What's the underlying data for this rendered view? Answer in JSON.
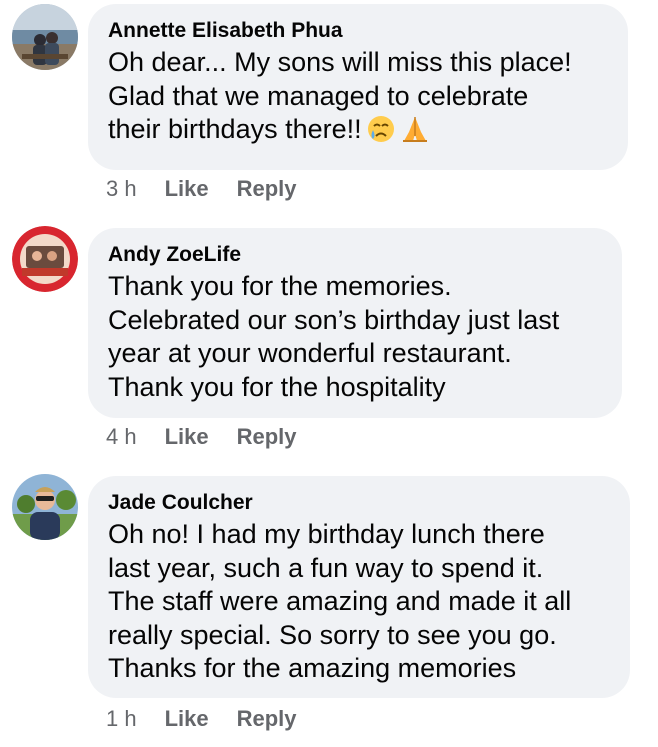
{
  "comments": [
    {
      "author": "Annette Elisabeth Phua",
      "lines": [
        "Oh dear... My sons will miss this place!",
        "Glad that we managed to celebrate",
        "their birthdays there!!"
      ],
      "emojis": [
        "crying-face",
        "folded-hands"
      ],
      "time": "3 h",
      "like": "Like",
      "reply": "Reply"
    },
    {
      "author": "Andy ZoeLife",
      "lines": [
        "Thank you for the memories.",
        "Celebrated our son’s birthday just last",
        "year at your wonderful restaurant.",
        "Thank you for the hospitality"
      ],
      "time": "4 h",
      "like": "Like",
      "reply": "Reply"
    },
    {
      "author": "Jade Coulcher",
      "lines": [
        "Oh no! I had my birthday lunch there",
        "last year, such a fun way to spend it.",
        "The staff were amazing and made it all",
        "really special. So sorry to see you go.",
        "Thanks for the amazing memories"
      ],
      "time": "1 h",
      "like": "Like",
      "reply": "Reply"
    }
  ],
  "colors": {
    "bubble_bg": "#f0f2f5",
    "text": "#050505",
    "meta": "#65676b"
  }
}
